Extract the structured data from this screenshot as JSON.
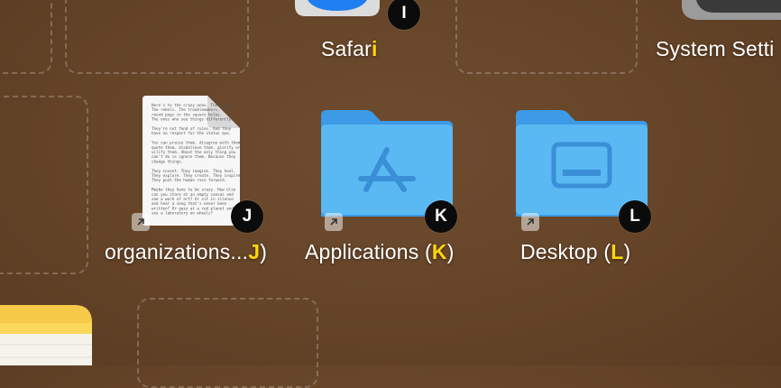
{
  "desktop": {
    "icons": [
      {
        "id": "safari",
        "label_main": "Safar",
        "label_hint": "i",
        "label_tail": "",
        "badge": "I"
      },
      {
        "id": "system-settings",
        "label_main": "System Setti",
        "label_hint": "",
        "label_tail": "",
        "badge": ""
      },
      {
        "id": "document",
        "label_main": "organizations...",
        "label_hint": "J",
        "label_tail": ")",
        "badge": "J"
      },
      {
        "id": "applications",
        "label_main": "Applications (",
        "label_hint": "K",
        "label_tail": ")",
        "badge": "K"
      },
      {
        "id": "desktop",
        "label_main": "Desktop (",
        "label_hint": "L",
        "label_tail": ")",
        "badge": "L"
      }
    ],
    "document_preview_lines": [
      "Here's to the crazy ones. The misfits.",
      "The rebels. The troublemakers. The",
      "round pegs in the square holes.",
      "The ones who see things differently.",
      "",
      "They're not fond of rules. And they",
      "have no respect for the status quo.",
      "",
      "You can praise them, disagree with them,",
      "quote them, disbelieve them, glorify or",
      "vilify them. About the only thing you",
      "can't do is ignore them. Because they",
      "change things.",
      "",
      "They invent. They imagine. They heal.",
      "They explore. They create. They inspire.",
      "They push the human race forward.",
      "",
      "Maybe they have to be crazy. How else",
      "can you stare at an empty canvas and",
      "see a work of art? Or sit in silence",
      "and hear a song that's never been",
      "written? Or gaze at a red planet and",
      "see a laboratory on wheels?"
    ]
  },
  "colors": {
    "desktop_bg": "#654428",
    "hint": "#ffd60a",
    "folder_front": "#5ab8f3",
    "folder_back": "#3d9ae6",
    "badge_bg": "#0b0b0b"
  }
}
